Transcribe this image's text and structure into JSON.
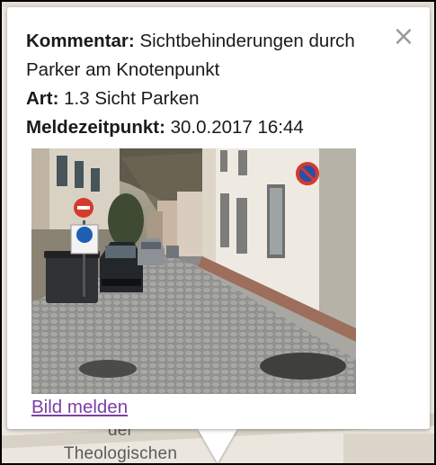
{
  "popup": {
    "comment_label": "Kommentar:",
    "comment_value": "Sichtbehinderungen durch Parker am Knotenpunkt",
    "type_label": "Art:",
    "type_value": "1.3 Sicht Parken",
    "time_label": "Meldezeitpunkt:",
    "time_value": "30.0.2017 16:44",
    "close_glyph": "×",
    "report_link": "Bild melden"
  },
  "map": {
    "label_line1": "der",
    "label_line2": "Theologischen"
  },
  "icons": {
    "close": "close-icon",
    "no_parking": "no-parking-sign-icon",
    "no_entry": "no-entry-sign-icon",
    "bicycle": "bicycle-sign-icon"
  },
  "colors": {
    "link": "#7b3fa5",
    "close": "#9a9a9a",
    "text": "#1a1a1a"
  }
}
